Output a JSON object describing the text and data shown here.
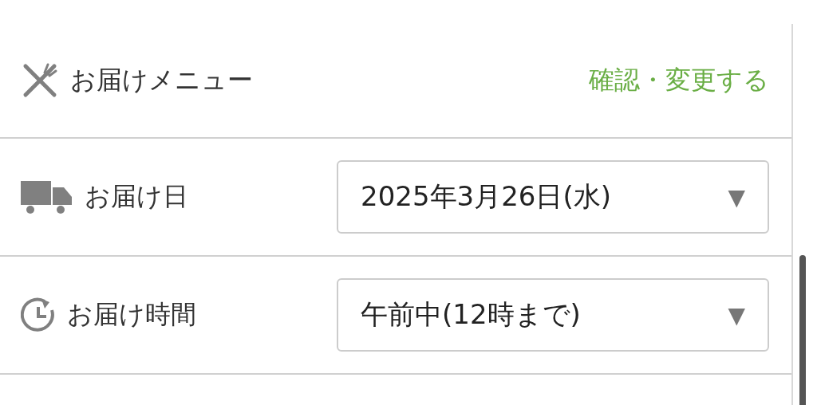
{
  "rows": [
    {
      "kind": "link",
      "label": "お届けメニュー",
      "action": "確認・変更する"
    },
    {
      "kind": "select",
      "label": "お届け日",
      "value": "2025年3月26日(水)",
      "caret": "▼"
    },
    {
      "kind": "select",
      "label": "お届け時間",
      "value": "午前中(12時まで)",
      "caret": "▼"
    }
  ]
}
